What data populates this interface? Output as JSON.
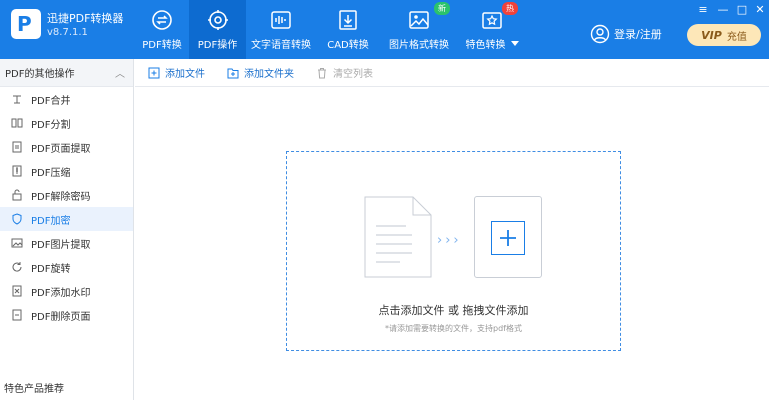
{
  "app": {
    "title": "迅捷PDF转换器",
    "version": "v8.7.1.1",
    "logo_letter": "P"
  },
  "nav": [
    {
      "label": "PDF转换",
      "icon": "refresh-swap-icon"
    },
    {
      "label": "PDF操作",
      "icon": "gear-icon",
      "active": true
    },
    {
      "label": "文字语音转换",
      "icon": "audio-wave-icon"
    },
    {
      "label": "CAD转换",
      "icon": "cad-download-icon"
    },
    {
      "label": "图片格式转换",
      "icon": "image-icon",
      "badge": "新"
    },
    {
      "label": "特色转换",
      "icon": "star-box-icon",
      "badge": "热"
    }
  ],
  "header": {
    "login_label": "登录/注册",
    "vip_label": "VIP",
    "recharge_label": "充值"
  },
  "window_controls": {
    "menu": "≡",
    "minimize": "—",
    "maximize": "□",
    "close": "✕"
  },
  "sidebar": {
    "section_title": "PDF的其他操作",
    "items": [
      {
        "label": "PDF合并"
      },
      {
        "label": "PDF分割"
      },
      {
        "label": "PDF页面提取"
      },
      {
        "label": "PDF压缩"
      },
      {
        "label": "PDF解除密码"
      },
      {
        "label": "PDF加密",
        "active": true
      },
      {
        "label": "PDF图片提取"
      },
      {
        "label": "PDF旋转"
      },
      {
        "label": "PDF添加水印"
      },
      {
        "label": "PDF删除页面"
      }
    ],
    "footer": "特色产品推荐"
  },
  "toolbar": {
    "add_file": "添加文件",
    "add_folder": "添加文件夹",
    "clear_list": "清空列表"
  },
  "dropzone": {
    "arrows": "›››",
    "main_text": "点击添加文件 或 拖拽文件添加",
    "sub_text": "*请添加需要转换的文件，支持pdf格式"
  },
  "colors": {
    "header_blue": "#1a7ee6",
    "active_blue": "#0d6bd0",
    "vip_gold": "#fde7b8",
    "badge_new": "#2bc36b",
    "badge_hot": "#f0423b"
  }
}
